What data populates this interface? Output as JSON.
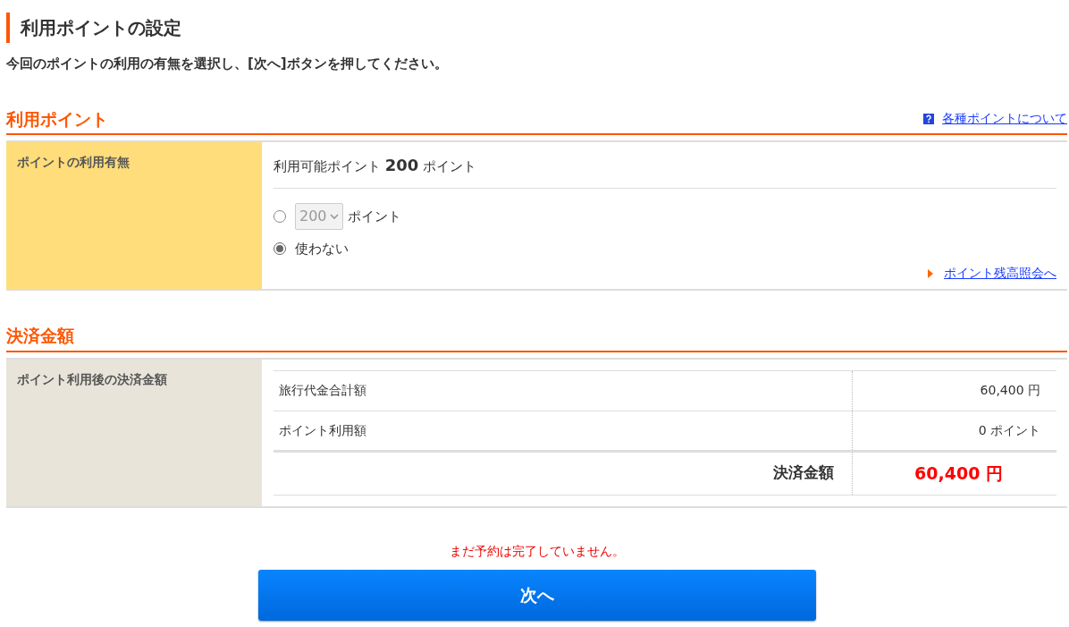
{
  "page_title": "利用ポイントの設定",
  "instruction": "今回のポイントの利用の有無を選択し、[次へ]ボタンを押してください。",
  "points_section": {
    "heading": "利用ポイント",
    "help_link": "各種ポイントについて",
    "row_label": "ポイントの利用有無",
    "available": {
      "prefix": "利用可能ポイント",
      "value": "200",
      "unit": "ポイント"
    },
    "options": [
      {
        "kind": "select",
        "selected": false,
        "disabled": true,
        "select_value": "200",
        "unit": "ポイント"
      },
      {
        "kind": "label",
        "selected": true,
        "label": "使わない"
      }
    ],
    "balance_link": "ポイント残高照会へ"
  },
  "payment_section": {
    "heading": "決済金額",
    "row_label": "ポイント利用後の決済金額",
    "rows": [
      {
        "kind": "item",
        "label": "旅行代金合計額",
        "value": "60,400 円"
      },
      {
        "kind": "item",
        "label": "ポイント利用額",
        "value": "0 ポイント"
      },
      {
        "kind": "total",
        "label": "決済金額",
        "value": "60,400 円"
      }
    ]
  },
  "notice": "まだ予約は完了していません。",
  "next_button": "次へ"
}
